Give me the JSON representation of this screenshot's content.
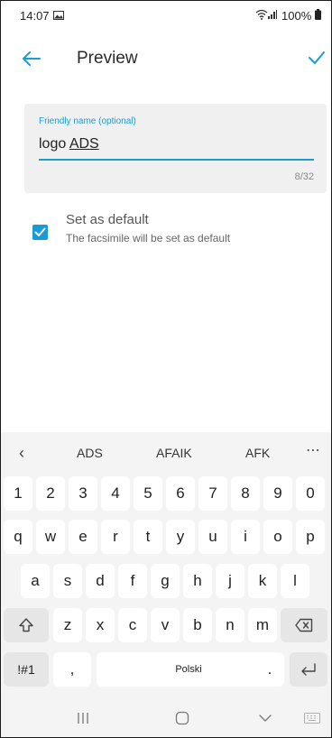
{
  "status": {
    "time": "14:07",
    "battery": "100%"
  },
  "app_bar": {
    "title": "Preview"
  },
  "name_field": {
    "label": "Friendly name (optional)",
    "value_prefix": "logo ",
    "value_underlined": "ADS",
    "counter": "8/32"
  },
  "default_option": {
    "title": "Set as default",
    "description": "The facsimile will be set as default",
    "checked": true
  },
  "keyboard": {
    "suggestions": [
      "ADS",
      "AFAIK",
      "AFK"
    ],
    "row_numbers": [
      "1",
      "2",
      "3",
      "4",
      "5",
      "6",
      "7",
      "8",
      "9",
      "0"
    ],
    "row_top": [
      "q",
      "w",
      "e",
      "r",
      "t",
      "y",
      "u",
      "i",
      "o",
      "p"
    ],
    "row_mid": [
      "a",
      "s",
      "d",
      "f",
      "g",
      "h",
      "j",
      "k",
      "l"
    ],
    "row_bottom": [
      "z",
      "x",
      "c",
      "v",
      "b",
      "n",
      "m"
    ],
    "symbols_label": "!#1",
    "comma_label": ",",
    "space_label": "Polski",
    "period_label": "."
  },
  "colors": {
    "accent": "#1a9bd4",
    "card_bg": "#f0f0f0",
    "keyboard_bg": "#f4f4f4"
  },
  "icons": [
    "back-arrow-icon",
    "check-icon",
    "shift-icon",
    "backspace-icon",
    "enter-icon",
    "recents-icon",
    "home-icon",
    "back-nav-icon",
    "keyboard-hide-icon"
  ]
}
